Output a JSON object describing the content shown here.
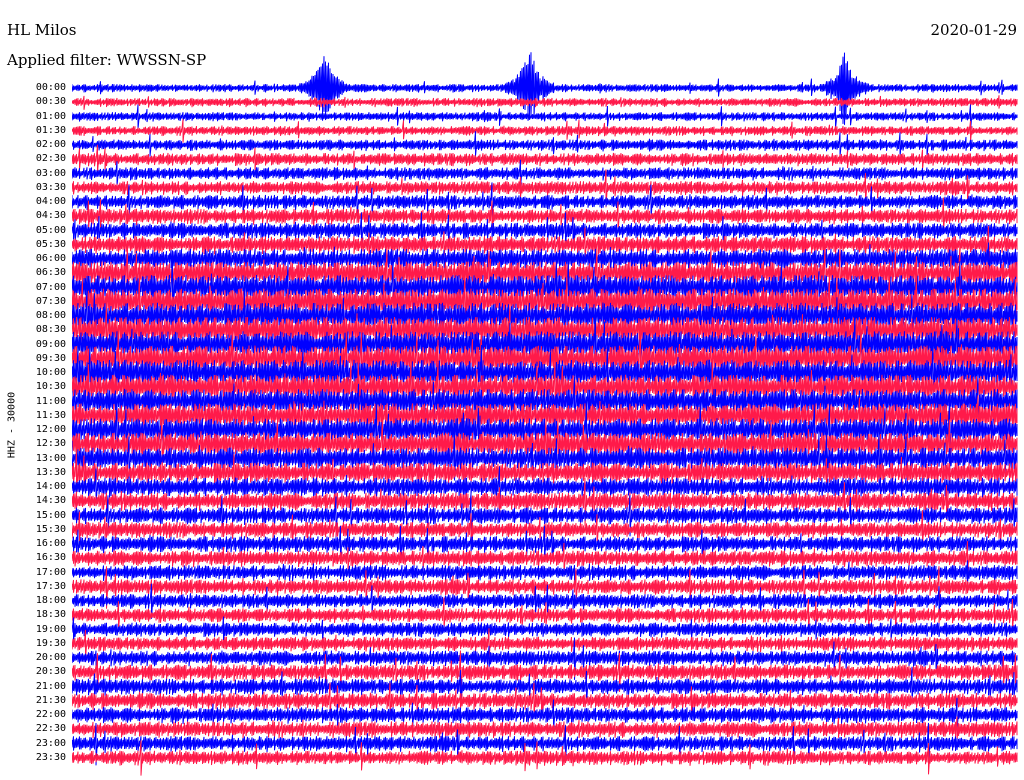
{
  "header": {
    "station": "HL Milos",
    "date": "2020-01-29",
    "filter": "Applied filter: WWSSN-SP",
    "channel": "HHZ - 30000"
  },
  "chart_data": {
    "type": "line",
    "title": "HL Milos",
    "subtitle": "Applied filter: WWSSN-SP",
    "date": "2020-01-29",
    "ylabel": "HHZ - 30000",
    "row_labels": [
      "00:00",
      "00:30",
      "01:00",
      "01:30",
      "02:00",
      "02:30",
      "03:00",
      "03:30",
      "04:00",
      "04:30",
      "05:00",
      "05:30",
      "06:00",
      "06:30",
      "07:00",
      "07:30",
      "08:00",
      "08:30",
      "09:00",
      "09:30",
      "10:00",
      "10:30",
      "11:00",
      "11:30",
      "12:00",
      "12:30",
      "13:00",
      "13:30",
      "14:00",
      "14:30",
      "15:00",
      "15:30",
      "16:00",
      "16:30",
      "17:00",
      "17:30",
      "18:00",
      "18:30",
      "19:00",
      "19:30",
      "20:00",
      "20:30",
      "21:00",
      "21:30",
      "22:00",
      "22:30",
      "23:00",
      "23:30"
    ],
    "trace_colors": [
      "#0000ff",
      "#ff1a4a"
    ],
    "row_noise": [
      0.5,
      0.55,
      0.55,
      0.6,
      0.7,
      0.8,
      0.8,
      0.85,
      0.9,
      0.95,
      1.0,
      1.1,
      1.3,
      1.5,
      1.6,
      1.7,
      1.7,
      1.7,
      1.7,
      1.7,
      1.7,
      1.6,
      1.6,
      1.6,
      1.5,
      1.5,
      1.4,
      1.3,
      1.2,
      1.1,
      1.05,
      1.0,
      1.0,
      1.0,
      0.95,
      0.95,
      0.9,
      0.9,
      0.9,
      0.9,
      0.95,
      1.0,
      1.0,
      1.0,
      1.0,
      1.0,
      0.95,
      0.9
    ],
    "events": [
      {
        "row": 0,
        "minute": 8.0,
        "amplitude": 5.5
      },
      {
        "row": 0,
        "minute": 14.5,
        "amplitude": 6.0
      },
      {
        "row": 0,
        "minute": 24.5,
        "amplitude": 5.0
      }
    ]
  }
}
